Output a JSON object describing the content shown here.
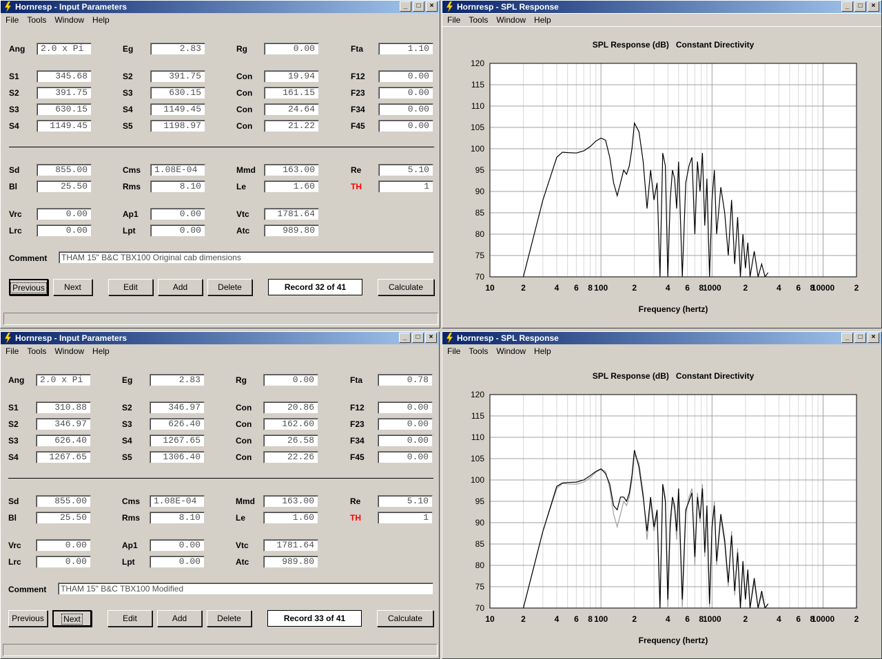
{
  "colors": {
    "title_start": "#0a246a",
    "title_end": "#a6caf0",
    "panel": "#d4d0c8",
    "red_label": "#ff0000"
  },
  "menu": [
    "File",
    "Tools",
    "Window",
    "Help"
  ],
  "title_buttons": {
    "minimize": "_",
    "maximize": "□",
    "close": "×"
  },
  "input_windows": [
    {
      "title": "Hornresp - Input Parameters",
      "rows": [
        [
          {
            "label": "Ang",
            "value": "2.0 x Pi",
            "left": true
          },
          {
            "label": "Eg",
            "value": "2.83"
          },
          {
            "label": "Rg",
            "value": "0.00"
          },
          {
            "label": "Fta",
            "value": "1.10"
          }
        ],
        [
          {
            "label": "S1",
            "value": "345.68"
          },
          {
            "label": "S2",
            "value": "391.75"
          },
          {
            "label": "Con",
            "value": "19.94"
          },
          {
            "label": "F12",
            "value": "0.00"
          }
        ],
        [
          {
            "label": "S2",
            "value": "391.75"
          },
          {
            "label": "S3",
            "value": "630.15"
          },
          {
            "label": "Con",
            "value": "161.15"
          },
          {
            "label": "F23",
            "value": "0.00"
          }
        ],
        [
          {
            "label": "S3",
            "value": "630.15"
          },
          {
            "label": "S4",
            "value": "1149.45"
          },
          {
            "label": "Con",
            "value": "24.64"
          },
          {
            "label": "F34",
            "value": "0.00"
          }
        ],
        [
          {
            "label": "S4",
            "value": "1149.45"
          },
          {
            "label": "S5",
            "value": "1198.97"
          },
          {
            "label": "Con",
            "value": "21.22"
          },
          {
            "label": "F45",
            "value": "0.00"
          }
        ],
        [
          {
            "label": "Sd",
            "value": "855.00"
          },
          {
            "label": "Cms",
            "value": "1.08E-04",
            "left": true
          },
          {
            "label": "Mmd",
            "value": "163.00"
          },
          {
            "label": "Re",
            "value": "5.10"
          }
        ],
        [
          {
            "label": "Bl",
            "value": "25.50"
          },
          {
            "label": "Rms",
            "value": "8.10"
          },
          {
            "label": "Le",
            "value": "1.60"
          },
          {
            "label": "TH",
            "value": "1",
            "red": true
          }
        ],
        [
          {
            "label": "Vrc",
            "value": "0.00"
          },
          {
            "label": "Ap1",
            "value": "0.00"
          },
          {
            "label": "Vtc",
            "value": "1781.64"
          }
        ],
        [
          {
            "label": "Lrc",
            "value": "0.00"
          },
          {
            "label": "Lpt",
            "value": "0.00"
          },
          {
            "label": "Atc",
            "value": "989.80"
          }
        ]
      ],
      "comment_label": "Comment",
      "comment": "THAM 15\" B&C TBX100 Original cab dimensions",
      "buttons": {
        "previous": "Previous",
        "next": "Next",
        "edit": "Edit",
        "add": "Add",
        "delete": "Delete",
        "calculate": "Calculate"
      },
      "record": "Record 32 of 41",
      "default_button": "previous"
    },
    {
      "title": "Hornresp - Input Parameters",
      "rows": [
        [
          {
            "label": "Ang",
            "value": "2.0 x Pi",
            "left": true
          },
          {
            "label": "Eg",
            "value": "2.83"
          },
          {
            "label": "Rg",
            "value": "0.00"
          },
          {
            "label": "Fta",
            "value": "0.78"
          }
        ],
        [
          {
            "label": "S1",
            "value": "310.88"
          },
          {
            "label": "S2",
            "value": "346.97"
          },
          {
            "label": "Con",
            "value": "20.86"
          },
          {
            "label": "F12",
            "value": "0.00"
          }
        ],
        [
          {
            "label": "S2",
            "value": "346.97"
          },
          {
            "label": "S3",
            "value": "626.40"
          },
          {
            "label": "Con",
            "value": "162.60"
          },
          {
            "label": "F23",
            "value": "0.00"
          }
        ],
        [
          {
            "label": "S3",
            "value": "626.40"
          },
          {
            "label": "S4",
            "value": "1267.65"
          },
          {
            "label": "Con",
            "value": "26.58"
          },
          {
            "label": "F34",
            "value": "0.00"
          }
        ],
        [
          {
            "label": "S4",
            "value": "1267.65"
          },
          {
            "label": "S5",
            "value": "1306.40"
          },
          {
            "label": "Con",
            "value": "22.26"
          },
          {
            "label": "F45",
            "value": "0.00"
          }
        ],
        [
          {
            "label": "Sd",
            "value": "855.00"
          },
          {
            "label": "Cms",
            "value": "1.08E-04",
            "left": true
          },
          {
            "label": "Mmd",
            "value": "163.00"
          },
          {
            "label": "Re",
            "value": "5.10"
          }
        ],
        [
          {
            "label": "Bl",
            "value": "25.50"
          },
          {
            "label": "Rms",
            "value": "8.10"
          },
          {
            "label": "Le",
            "value": "1.60"
          },
          {
            "label": "TH",
            "value": "1",
            "red": true
          }
        ],
        [
          {
            "label": "Vrc",
            "value": "0.00"
          },
          {
            "label": "Ap1",
            "value": "0.00"
          },
          {
            "label": "Vtc",
            "value": "1781.64"
          }
        ],
        [
          {
            "label": "Lrc",
            "value": "0.00"
          },
          {
            "label": "Lpt",
            "value": "0.00"
          },
          {
            "label": "Atc",
            "value": "989.80"
          }
        ]
      ],
      "comment_label": "Comment",
      "comment": "THAM 15\" B&C TBX100 Modified",
      "buttons": {
        "previous": "Previous",
        "next": "Next",
        "edit": "Edit",
        "add": "Add",
        "delete": "Delete",
        "calculate": "Calculate"
      },
      "record": "Record 33 of 41",
      "default_button": "next"
    }
  ],
  "spl_windows": [
    {
      "title": "Hornresp - SPL Response"
    },
    {
      "title": "Hornresp - SPL Response"
    }
  ],
  "chart_data": [
    {
      "type": "line",
      "title": "SPL Response (dB)   Constant Directivity",
      "xlabel": "Frequency (hertz)",
      "ylabel": "",
      "xscale": "log",
      "xlim": [
        10,
        20000
      ],
      "ylim": [
        70,
        120
      ],
      "yticks": [
        70,
        75,
        80,
        85,
        90,
        95,
        100,
        105,
        110,
        115,
        120
      ],
      "xticklabels": [
        "10",
        "2",
        "4",
        "6",
        "8",
        "100",
        "2",
        "4",
        "6",
        "8",
        "1000",
        "2",
        "4",
        "6",
        "8",
        "10000",
        "2"
      ],
      "grid": true,
      "series": [
        {
          "color": "#000000",
          "x": [
            20,
            30,
            40,
            45,
            50,
            60,
            70,
            80,
            90,
            100,
            110,
            120,
            130,
            140,
            150,
            160,
            170,
            180,
            190,
            200,
            220,
            240,
            260,
            280,
            300,
            320,
            340,
            360,
            380,
            400,
            420,
            440,
            460,
            480,
            500,
            540,
            580,
            620,
            660,
            700,
            740,
            780,
            820,
            860,
            900,
            950,
            1000,
            1050,
            1100,
            1200,
            1300,
            1400,
            1500,
            1600,
            1700,
            1800,
            1900,
            2000,
            2100,
            2200,
            2400,
            2600,
            2800,
            3000,
            3200
          ],
          "y": [
            70,
            88,
            98,
            99.2,
            99.1,
            99.0,
            99.5,
            100.5,
            101.8,
            102.5,
            102.0,
            98,
            92,
            89,
            92,
            95,
            94,
            96,
            100,
            106,
            104,
            97,
            86,
            95,
            88,
            92,
            70,
            99,
            96,
            70,
            88,
            95,
            93,
            86,
            97,
            70,
            92,
            96,
            98,
            80,
            97,
            90,
            99,
            82,
            93,
            70,
            88,
            95,
            80,
            91,
            85,
            75,
            88,
            73,
            84,
            70,
            80,
            72,
            78,
            70,
            76,
            70,
            73,
            70,
            71
          ]
        }
      ]
    },
    {
      "type": "line",
      "title": "SPL Response (dB)   Constant Directivity",
      "xlabel": "Frequency (hertz)",
      "ylabel": "",
      "xscale": "log",
      "xlim": [
        10,
        20000
      ],
      "ylim": [
        70,
        120
      ],
      "yticks": [
        70,
        75,
        80,
        85,
        90,
        95,
        100,
        105,
        110,
        115,
        120
      ],
      "xticklabels": [
        "10",
        "2",
        "4",
        "6",
        "8",
        "100",
        "2",
        "4",
        "6",
        "8",
        "1000",
        "2",
        "4",
        "6",
        "8",
        "10000",
        "2"
      ],
      "grid": true,
      "series": [
        {
          "color": "#a0a0a0",
          "x": [
            20,
            30,
            40,
            45,
            50,
            60,
            70,
            80,
            90,
            100,
            110,
            120,
            130,
            140,
            150,
            160,
            170,
            180,
            190,
            200,
            220,
            240,
            260,
            280,
            300,
            320,
            340,
            360,
            380,
            400,
            420,
            440,
            460,
            480,
            500,
            540,
            580,
            620,
            660,
            700,
            740,
            780,
            820,
            860,
            900,
            950,
            1000,
            1050,
            1100,
            1200,
            1300,
            1400,
            1500,
            1600,
            1700,
            1800,
            1900,
            2000,
            2100,
            2200,
            2400,
            2600,
            2800,
            3000,
            3200
          ],
          "y": [
            70,
            88,
            98,
            99.2,
            99.1,
            99.0,
            99.5,
            100.5,
            101.8,
            102.5,
            102.0,
            98,
            92,
            89,
            92,
            95,
            94,
            96,
            100,
            106,
            104,
            97,
            86,
            95,
            88,
            92,
            70,
            99,
            96,
            70,
            88,
            95,
            93,
            86,
            97,
            70,
            92,
            96,
            98,
            80,
            97,
            90,
            99,
            82,
            93,
            70,
            88,
            95,
            80,
            91,
            85,
            75,
            88,
            73,
            84,
            70,
            80,
            72,
            78,
            70,
            76,
            70,
            73,
            70,
            71
          ]
        },
        {
          "color": "#000000",
          "x": [
            20,
            30,
            40,
            45,
            50,
            60,
            70,
            80,
            90,
            100,
            110,
            120,
            130,
            140,
            150,
            160,
            170,
            180,
            190,
            200,
            220,
            240,
            260,
            280,
            300,
            320,
            340,
            360,
            380,
            400,
            420,
            440,
            460,
            480,
            500,
            540,
            580,
            620,
            660,
            700,
            740,
            780,
            820,
            860,
            900,
            950,
            1000,
            1050,
            1100,
            1200,
            1300,
            1400,
            1500,
            1600,
            1700,
            1800,
            1900,
            2000,
            2100,
            2200,
            2400,
            2600,
            2800,
            3000,
            3200
          ],
          "y": [
            70,
            88,
            98.5,
            99.3,
            99.4,
            99.5,
            100.0,
            101.0,
            102.0,
            102.6,
            101.5,
            99,
            94,
            93,
            96,
            96,
            95,
            97,
            101,
            107,
            103,
            96,
            88,
            96,
            89,
            93,
            70,
            99,
            95,
            72,
            90,
            96,
            94,
            88,
            98,
            72,
            93,
            95,
            97,
            82,
            96,
            91,
            98,
            83,
            94,
            71,
            89,
            94,
            81,
            92,
            86,
            76,
            87,
            74,
            83,
            70,
            81,
            72,
            79,
            70,
            77,
            70,
            74,
            70,
            71
          ]
        }
      ]
    }
  ]
}
